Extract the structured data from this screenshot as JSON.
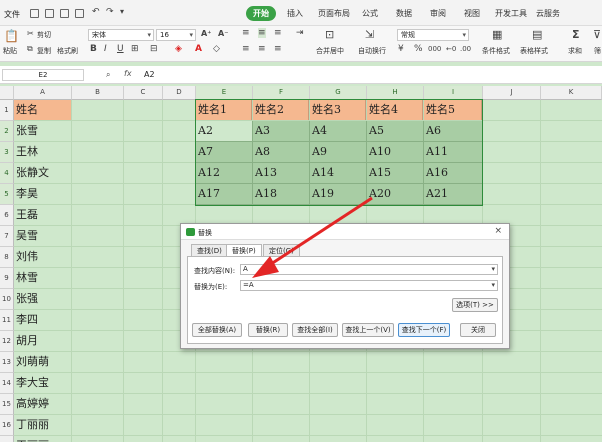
{
  "menu": {
    "file": "文件",
    "tabs": [
      "开始",
      "插入",
      "页面布局",
      "公式",
      "数据",
      "审阅",
      "视图",
      "开发工具",
      "云服务"
    ]
  },
  "ribbon": {
    "paste": "粘贴",
    "cut": "剪切",
    "copy": "复制",
    "format_painter": "格式刷",
    "font_name": "宋体",
    "font_size": "16",
    "merge_center": "合并居中",
    "wrap_text": "自动换行",
    "number_format": "常规",
    "conditional_format": "条件格式",
    "table_style": "表格样式",
    "sum": "求和",
    "filter": "筛"
  },
  "formula_bar": {
    "name_box": "E2",
    "fx": "fx",
    "content": "A2"
  },
  "sheet": {
    "columns": [
      "A",
      "B",
      "C",
      "D",
      "E",
      "F",
      "G",
      "H",
      "I",
      "J",
      "K"
    ],
    "rows": [
      "1",
      "2",
      "3",
      "4",
      "5",
      "6",
      "7",
      "8",
      "9",
      "10",
      "11",
      "12",
      "13",
      "14",
      "15",
      "16",
      "17"
    ],
    "col_a": [
      "姓名",
      "张雪",
      "王林",
      "张静文",
      "李昊",
      "王磊",
      "吴雪",
      "刘伟",
      "林雪",
      "张强",
      "李四",
      "胡月",
      "刘萌萌",
      "李大宝",
      "高婷婷",
      "丁丽丽",
      "王丽丽"
    ],
    "table_header": [
      "姓名1",
      "姓名2",
      "姓名3",
      "姓名4",
      "姓名5"
    ],
    "table_rows": [
      [
        "A2",
        "A3",
        "A4",
        "A5",
        "A6"
      ],
      [
        "A7",
        "A8",
        "A9",
        "A10",
        "A11"
      ],
      [
        "A12",
        "A13",
        "A14",
        "A15",
        "A16"
      ],
      [
        "A17",
        "A18",
        "A19",
        "A20",
        "A21"
      ]
    ]
  },
  "dialog": {
    "title": "替换",
    "close": "×",
    "tabs": [
      "查找(D)",
      "替换(P)",
      "定位(G)"
    ],
    "find_label": "查找内容(N):",
    "find_value": "A",
    "replace_label": "替换为(E):",
    "replace_value": "=A",
    "options_button": "选项(T) >>",
    "buttons": [
      "全部替换(A)",
      "替换(R)",
      "查找全部(I)",
      "查找上一个(V)",
      "查找下一个(F)",
      "关闭"
    ]
  },
  "colors": {
    "accent": "#3aa146",
    "header_fill": "#f5b890",
    "data_fill": "#a8cda4",
    "arrow": "#e32626"
  }
}
